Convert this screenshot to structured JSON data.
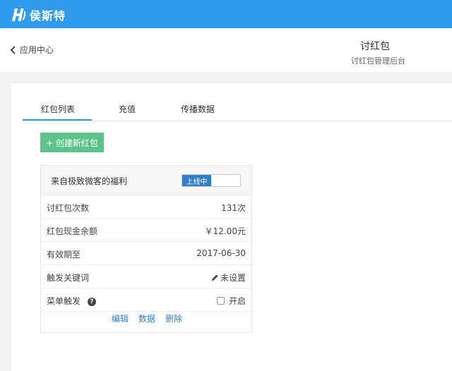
{
  "brand": {
    "name": "侯斯特",
    "color": "#2f9bea"
  },
  "header": {
    "back_label": "应用中心",
    "title": "讨红包",
    "subtitle": "讨红包管理后台"
  },
  "tabs": [
    {
      "label": "红包列表",
      "active": true
    },
    {
      "label": "充值",
      "active": false
    },
    {
      "label": "传播数据",
      "active": false
    }
  ],
  "create_button": {
    "label": "+ 创建新红包",
    "color": "#5ec28b"
  },
  "card": {
    "title": "来自极致微客的福利",
    "toggle_label": "上线中",
    "rows": [
      {
        "label": "讨红包次数",
        "value": "131次"
      },
      {
        "label": "红包现金余额",
        "value": "￥12.00元"
      },
      {
        "label": "有效期至",
        "value": "2017-06-30"
      },
      {
        "label": "触发关键词",
        "value": "未设置",
        "icon": "pencil-icon"
      },
      {
        "label": "菜单触发",
        "value": "开启",
        "icon": "question-circle-icon"
      }
    ],
    "actions": [
      "编辑",
      "数据",
      "删除"
    ]
  }
}
